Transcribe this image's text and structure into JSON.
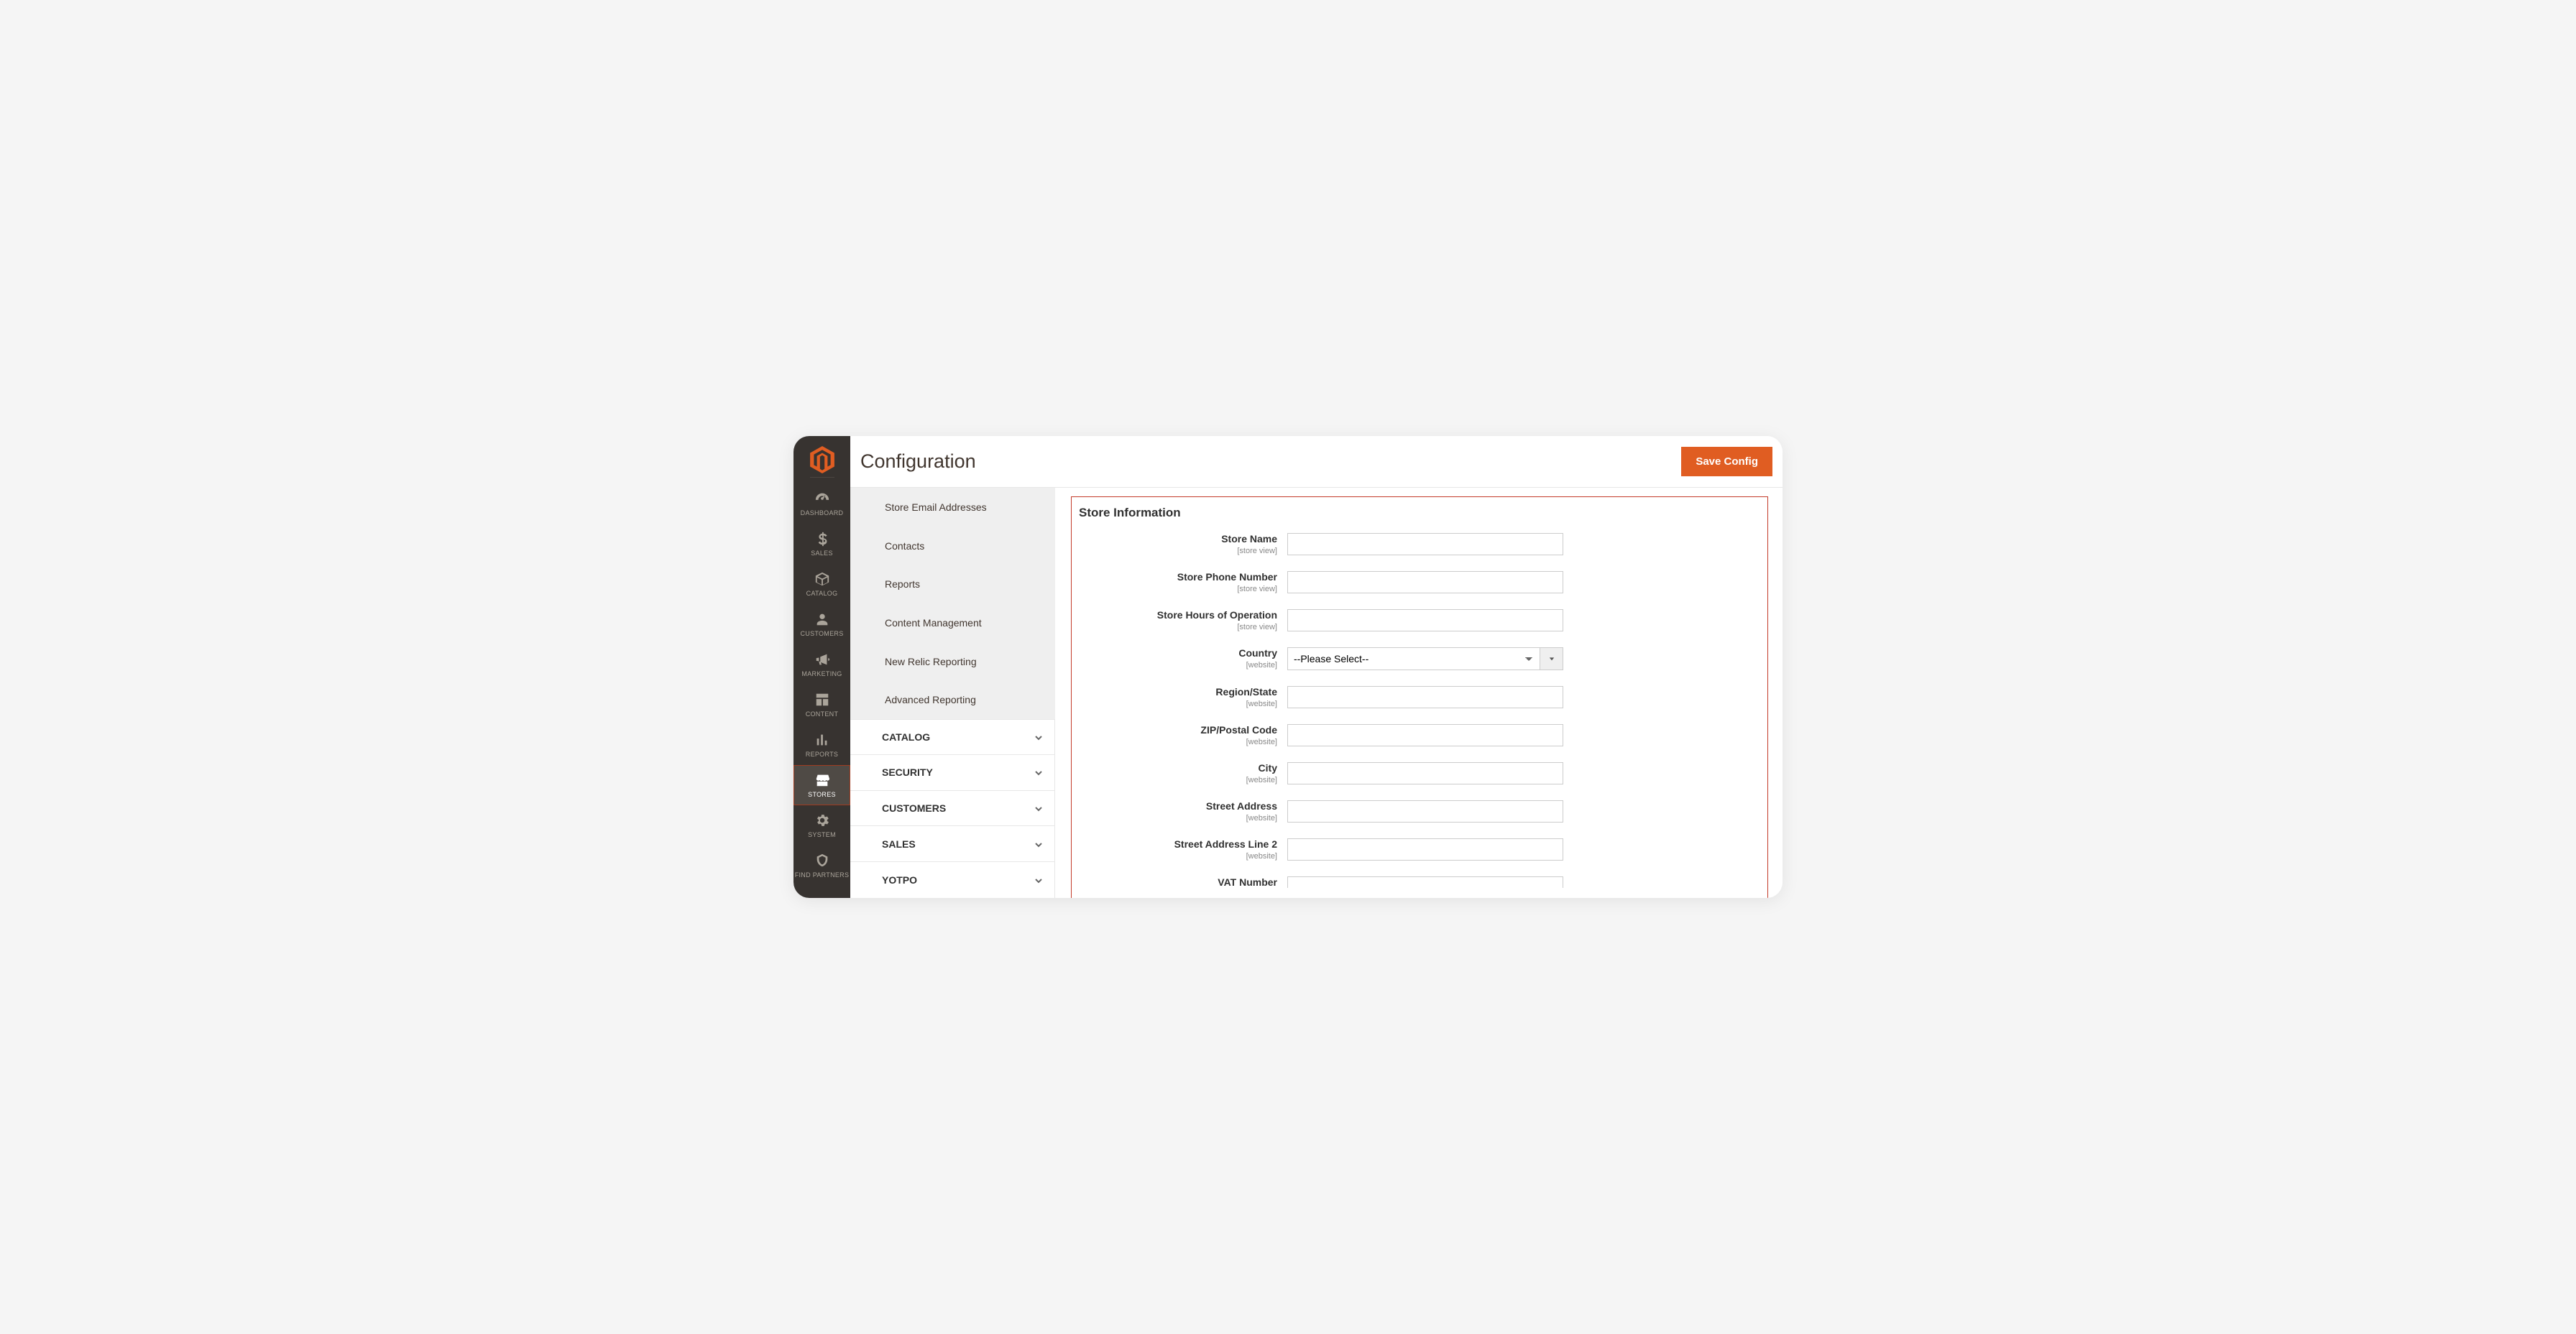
{
  "header": {
    "title": "Configuration",
    "save_label": "Save Config"
  },
  "nav": {
    "items": [
      {
        "id": "dashboard",
        "label": "DASHBOARD"
      },
      {
        "id": "sales",
        "label": "SALES"
      },
      {
        "id": "catalog",
        "label": "CATALOG"
      },
      {
        "id": "customers",
        "label": "CUSTOMERS"
      },
      {
        "id": "marketing",
        "label": "MARKETING"
      },
      {
        "id": "content",
        "label": "CONTENT"
      },
      {
        "id": "reports",
        "label": "REPORTS"
      },
      {
        "id": "stores",
        "label": "STORES",
        "active": true
      },
      {
        "id": "system",
        "label": "SYSTEM"
      },
      {
        "id": "partners",
        "label": "FIND PARTNERS"
      }
    ]
  },
  "sidebar": {
    "sub_items": [
      "Store Email Addresses",
      "Contacts",
      "Reports",
      "Content Management",
      "New Relic Reporting",
      "Advanced Reporting"
    ],
    "sections": [
      "CATALOG",
      "SECURITY",
      "CUSTOMERS",
      "SALES",
      "YOTPO"
    ]
  },
  "panel": {
    "title": "Store Information",
    "scope_storeview": "[store view]",
    "scope_website": "[website]",
    "country_placeholder": "--Please Select--",
    "fields": {
      "store_name": {
        "label": "Store Name",
        "scope": "storeview",
        "value": ""
      },
      "store_phone": {
        "label": "Store Phone Number",
        "scope": "storeview",
        "value": ""
      },
      "store_hours": {
        "label": "Store Hours of Operation",
        "scope": "storeview",
        "value": ""
      },
      "country": {
        "label": "Country",
        "scope": "website",
        "value": ""
      },
      "region_state": {
        "label": "Region/State",
        "scope": "website",
        "value": ""
      },
      "zip": {
        "label": "ZIP/Postal Code",
        "scope": "website",
        "value": ""
      },
      "city": {
        "label": "City",
        "scope": "website",
        "value": ""
      },
      "street1": {
        "label": "Street Address",
        "scope": "website",
        "value": ""
      },
      "street2": {
        "label": "Street Address Line 2",
        "scope": "website",
        "value": ""
      },
      "vat": {
        "label": "VAT Number",
        "scope": "website",
        "value": ""
      }
    }
  }
}
